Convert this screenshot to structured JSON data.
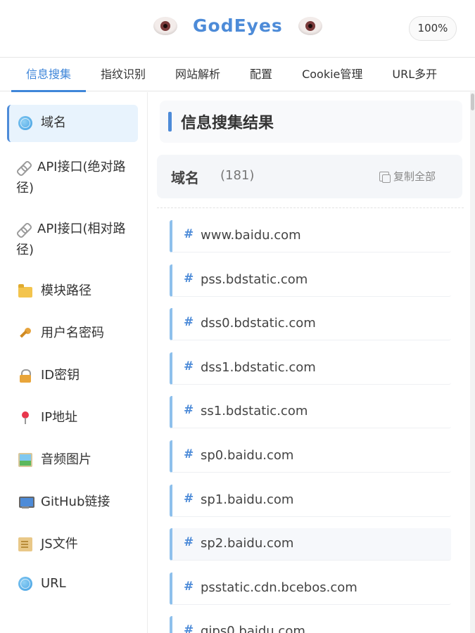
{
  "header": {
    "title": "GodEyes",
    "zoom": "100%"
  },
  "tabs": [
    {
      "label": "信息搜集",
      "active": true
    },
    {
      "label": "指纹识别"
    },
    {
      "label": "网站解析"
    },
    {
      "label": "配置"
    },
    {
      "label": "Cookie管理"
    },
    {
      "label": "URL多开"
    }
  ],
  "sidebar": {
    "items": [
      {
        "label": "域名",
        "icon": "globe-icon",
        "active": true
      },
      {
        "label": "API接口(绝对路径)",
        "icon": "link-icon"
      },
      {
        "label": "API接口(相对路径)",
        "icon": "link-icon"
      },
      {
        "label": "模块路径",
        "icon": "folder-icon"
      },
      {
        "label": "用户名密码",
        "icon": "key-icon"
      },
      {
        "label": "ID密钥",
        "icon": "lock-icon"
      },
      {
        "label": "IP地址",
        "icon": "pin-icon"
      },
      {
        "label": "音频图片",
        "icon": "image-icon"
      },
      {
        "label": "GitHub链接",
        "icon": "monitor-icon"
      },
      {
        "label": "JS文件",
        "icon": "scroll-icon"
      },
      {
        "label": "URL",
        "icon": "globe-icon"
      }
    ]
  },
  "main": {
    "title": "信息搜集结果",
    "section": {
      "name": "域名",
      "count": "(181)",
      "copy_label": "复制全部"
    },
    "domains": [
      "www.baidu.com",
      "pss.bdstatic.com",
      "dss0.bdstatic.com",
      "dss1.bdstatic.com",
      "ss1.bdstatic.com",
      "sp0.baidu.com",
      "sp1.baidu.com",
      "sp2.baidu.com",
      "psstatic.cdn.bcebos.com",
      "gips0.baidu.com"
    ]
  },
  "colors": {
    "accent": "#4d8bd8",
    "item_border": "#8ec0ec"
  }
}
